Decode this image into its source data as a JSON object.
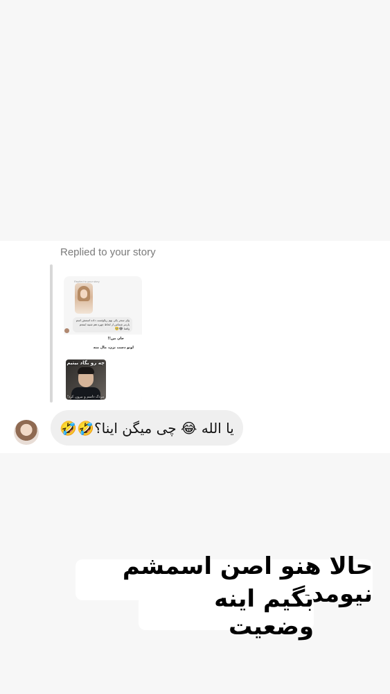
{
  "chat": {
    "replied_label": "Replied to your story",
    "story_preview": {
      "replied_label": "Replied to your story",
      "reply_text": "وای سحر یکی بهم ریکوئست داده اسمش اسم پارتنر شماس از لحاظ چهره هم شبیه ایمجم واقعا",
      "reply_emojis": "😂🥹",
      "post_line1": "جان من!!",
      "post_line2": "اونو دست نزن، مال منه",
      "photo_caption_top": "چه رو بگاد بیتیم",
      "photo_caption_bottom": "مردک داسم و بیرون کرد!"
    },
    "message_text": "یا الله 😂 چی میگن اینا؟🤣🤣"
  },
  "caption": {
    "line1": "حالا هنو اصن اسمشم نیومدیم",
    "line2": "بگیم اینه وضعیت"
  }
}
